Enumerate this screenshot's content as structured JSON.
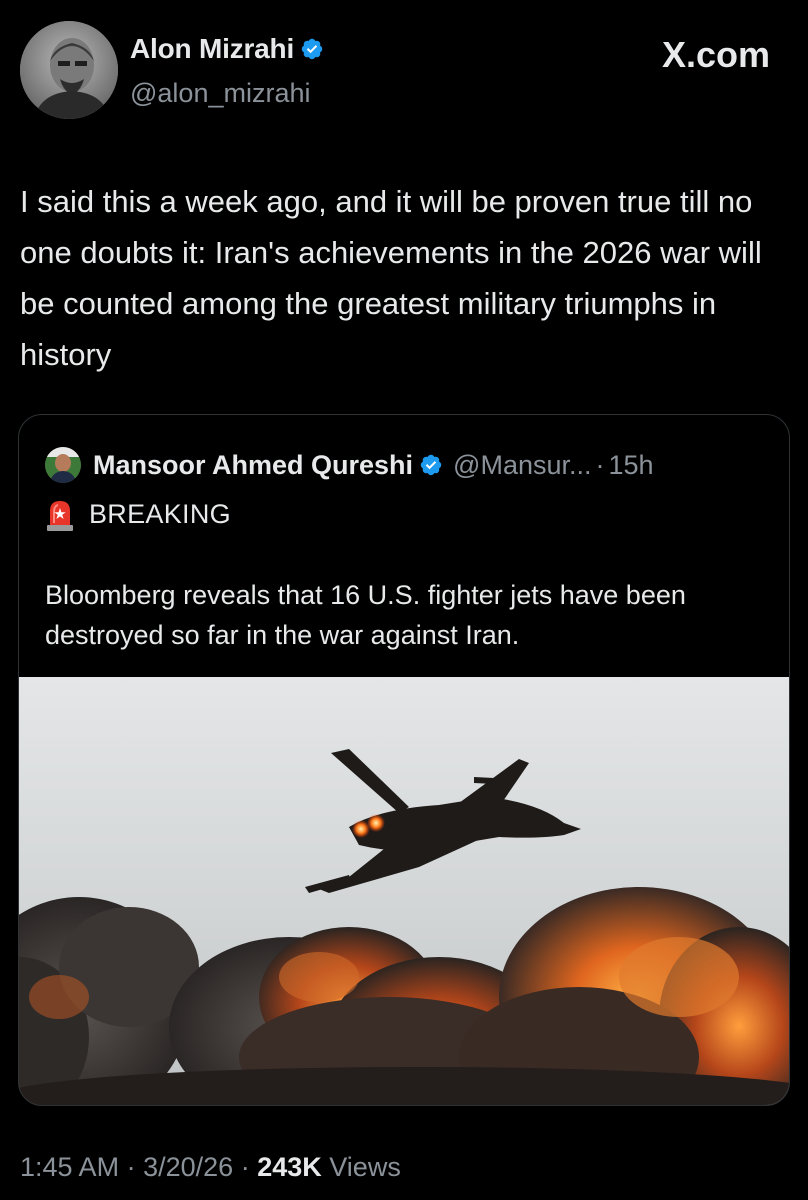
{
  "brand": {
    "label": "X.com"
  },
  "author": {
    "name": "Alon Mizrahi",
    "handle": "@alon_mizrahi",
    "verified": true
  },
  "tweet": {
    "text": "I said this a week ago, and it will be proven true till no one doubts it: Iran's achievements in the 2026 war will be counted among the greatest military triumphs in history"
  },
  "quoted_tweet": {
    "author_name": "Mansoor Ahmed Qureshi",
    "handle": "@Mansur...",
    "separator": "·",
    "time": "15h",
    "verified": true,
    "breaking_label": "BREAKING",
    "breaking_icon": "police-siren-icon",
    "text": "Bloomberg reveals that 16 U.S. fighter jets have been destroyed so far in the war against Iran."
  },
  "footer": {
    "time": "1:45 AM",
    "separator": "·",
    "date": "3/20/26",
    "views_count": "243K",
    "views_label": "Views"
  },
  "colors": {
    "background": "#000000",
    "text_primary": "#e7e9ea",
    "text_secondary": "#8b9299",
    "verified_blue": "#1d9bf0",
    "border": "#2f3336"
  }
}
